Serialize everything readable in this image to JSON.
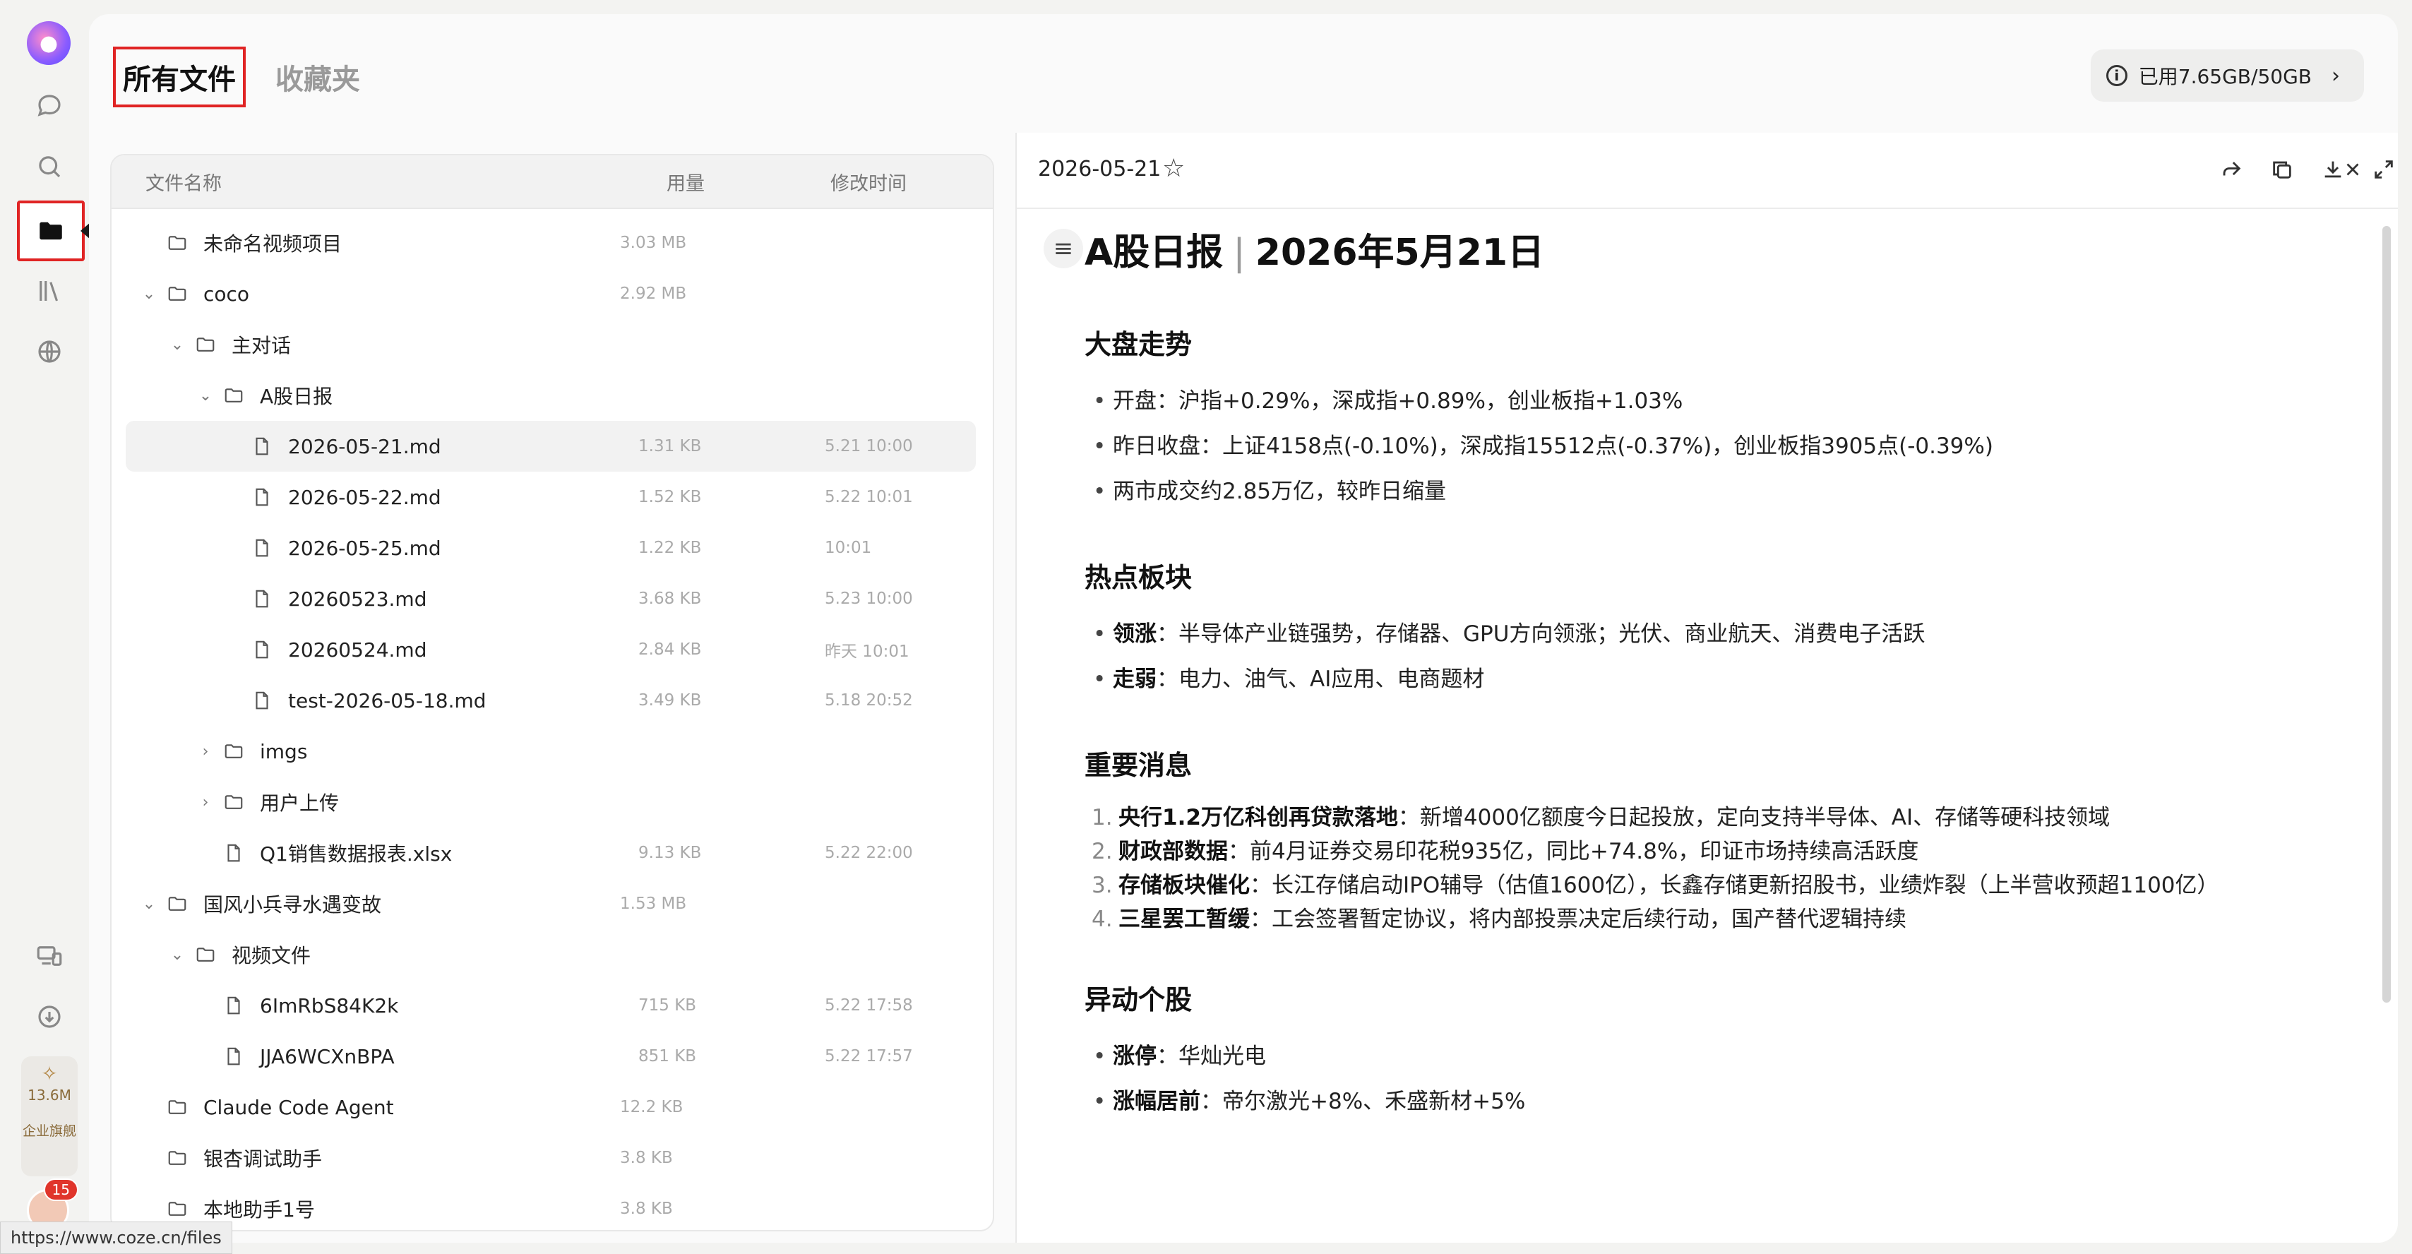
{
  "sidebar": {
    "tooltip": "文件",
    "quota_amount": "13.6M",
    "quota_tier": "企业旗舰",
    "notification_count": "15"
  },
  "status_url": "https://www.coze.cn/files",
  "header": {
    "tab_all": "所有文件",
    "tab_favorites": "收藏夹",
    "storage_label": "已用7.65GB/50GB"
  },
  "file_list": {
    "columns": {
      "name": "文件名称",
      "size": "用量",
      "time": "修改时间"
    },
    "rows": [
      {
        "name": "未命名视频项目",
        "size": "3.03 MB",
        "time": "",
        "kind": "folder",
        "depth": 0,
        "expanded": false,
        "has_chevron": false
      },
      {
        "name": "coco",
        "size": "2.92 MB",
        "time": "",
        "kind": "folder",
        "depth": 0,
        "expanded": true,
        "has_chevron": true
      },
      {
        "name": "主对话",
        "size": "",
        "time": "",
        "kind": "folder",
        "depth": 1,
        "expanded": true,
        "has_chevron": true
      },
      {
        "name": "A股日报",
        "size": "",
        "time": "",
        "kind": "folder",
        "depth": 2,
        "expanded": true,
        "has_chevron": true
      },
      {
        "name": "2026-05-21.md",
        "size": "1.31 KB",
        "time": "5.21 10:00",
        "kind": "file",
        "depth": 3,
        "selected": true
      },
      {
        "name": "2026-05-22.md",
        "size": "1.52 KB",
        "time": "5.22 10:01",
        "kind": "file",
        "depth": 3
      },
      {
        "name": "2026-05-25.md",
        "size": "1.22 KB",
        "time": "10:01",
        "kind": "file",
        "depth": 3
      },
      {
        "name": "20260523.md",
        "size": "3.68 KB",
        "time": "5.23 10:00",
        "kind": "file",
        "depth": 3
      },
      {
        "name": "20260524.md",
        "size": "2.84 KB",
        "time": "昨天 10:01",
        "kind": "file",
        "depth": 3
      },
      {
        "name": "test-2026-05-18.md",
        "size": "3.49 KB",
        "time": "5.18 20:52",
        "kind": "file",
        "depth": 3
      },
      {
        "name": "imgs",
        "size": "",
        "time": "",
        "kind": "folder",
        "depth": 2,
        "expanded": false,
        "has_chevron": true
      },
      {
        "name": "用户上传",
        "size": "",
        "time": "",
        "kind": "folder",
        "depth": 2,
        "expanded": false,
        "has_chevron": true
      },
      {
        "name": "Q1销售数据报表.xlsx",
        "size": "9.13 KB",
        "time": "5.22 22:00",
        "kind": "file",
        "depth": 2
      },
      {
        "name": "国风小兵寻水遇变故",
        "size": "1.53 MB",
        "time": "",
        "kind": "folder",
        "depth": 0,
        "expanded": true,
        "has_chevron": true
      },
      {
        "name": "视频文件",
        "size": "",
        "time": "",
        "kind": "folder",
        "depth": 1,
        "expanded": true,
        "has_chevron": true
      },
      {
        "name": "6ImRbS84K2k",
        "size": "715 KB",
        "time": "5.22 17:58",
        "kind": "file",
        "depth": 2
      },
      {
        "name": "JJA6WCXnBPA",
        "size": "851 KB",
        "time": "5.22 17:57",
        "kind": "file",
        "depth": 2
      },
      {
        "name": "Claude Code Agent",
        "size": "12.2 KB",
        "time": "",
        "kind": "folder",
        "depth": 0,
        "expanded": false,
        "has_chevron": false
      },
      {
        "name": "银杏调试助手",
        "size": "3.8 KB",
        "time": "",
        "kind": "folder",
        "depth": 0,
        "expanded": false,
        "has_chevron": false
      },
      {
        "name": "本地助手1号",
        "size": "3.8 KB",
        "time": "",
        "kind": "folder",
        "depth": 0,
        "expanded": false,
        "has_chevron": false
      }
    ]
  },
  "preview": {
    "date": "2026-05-21",
    "doc_title_left": "A股日报",
    "doc_title_right": "2026年5月21日",
    "sections": {
      "market": {
        "heading": "大盘走势",
        "items": [
          "开盘：沪指+0.29%，深成指+0.89%，创业板指+1.03%",
          "昨日收盘：上证4158点(-0.10%)，深成指15512点(-0.37%)，创业板指3905点(-0.39%)",
          "两市成交约2.85万亿，较昨日缩量"
        ]
      },
      "hot": {
        "heading": "热点板块",
        "items": [
          {
            "key": "领涨",
            "text": "：半导体产业链强势，存储器、GPU方向领涨；光伏、商业航天、消费电子活跃"
          },
          {
            "key": "走弱",
            "text": "：电力、油气、AI应用、电商题材"
          }
        ]
      },
      "news": {
        "heading": "重要消息",
        "items": [
          {
            "num": "1.",
            "key": "央行1.2万亿科创再贷款落地",
            "text": "：新增4000亿额度今日起投放，定向支持半导体、AI、存储等硬科技领域"
          },
          {
            "num": "2.",
            "key": "财政部数据",
            "text": "：前4月证券交易印花税935亿，同比+74.8%，印证市场持续高活跃度"
          },
          {
            "num": "3.",
            "key": "存储板块催化",
            "text": "：长江存储启动IPO辅导（估值1600亿），长鑫存储更新招股书，业绩炸裂（上半营收预超1100亿）"
          },
          {
            "num": "4.",
            "key": "三星罢工暂缓",
            "text": "：工会签署暂定协议，将内部投票决定后续行动，国产替代逻辑持续"
          }
        ]
      },
      "stocks": {
        "heading": "异动个股",
        "items": [
          {
            "key": "涨停",
            "text": "：华灿光电"
          },
          {
            "key": "涨幅居前",
            "text": "：帝尔激光+8%、禾盛新材+5%"
          }
        ]
      }
    }
  },
  "colors": {
    "highlight": "#e02424",
    "app_bg": "#f3f3f1",
    "panel_bg": "#ffffff"
  }
}
